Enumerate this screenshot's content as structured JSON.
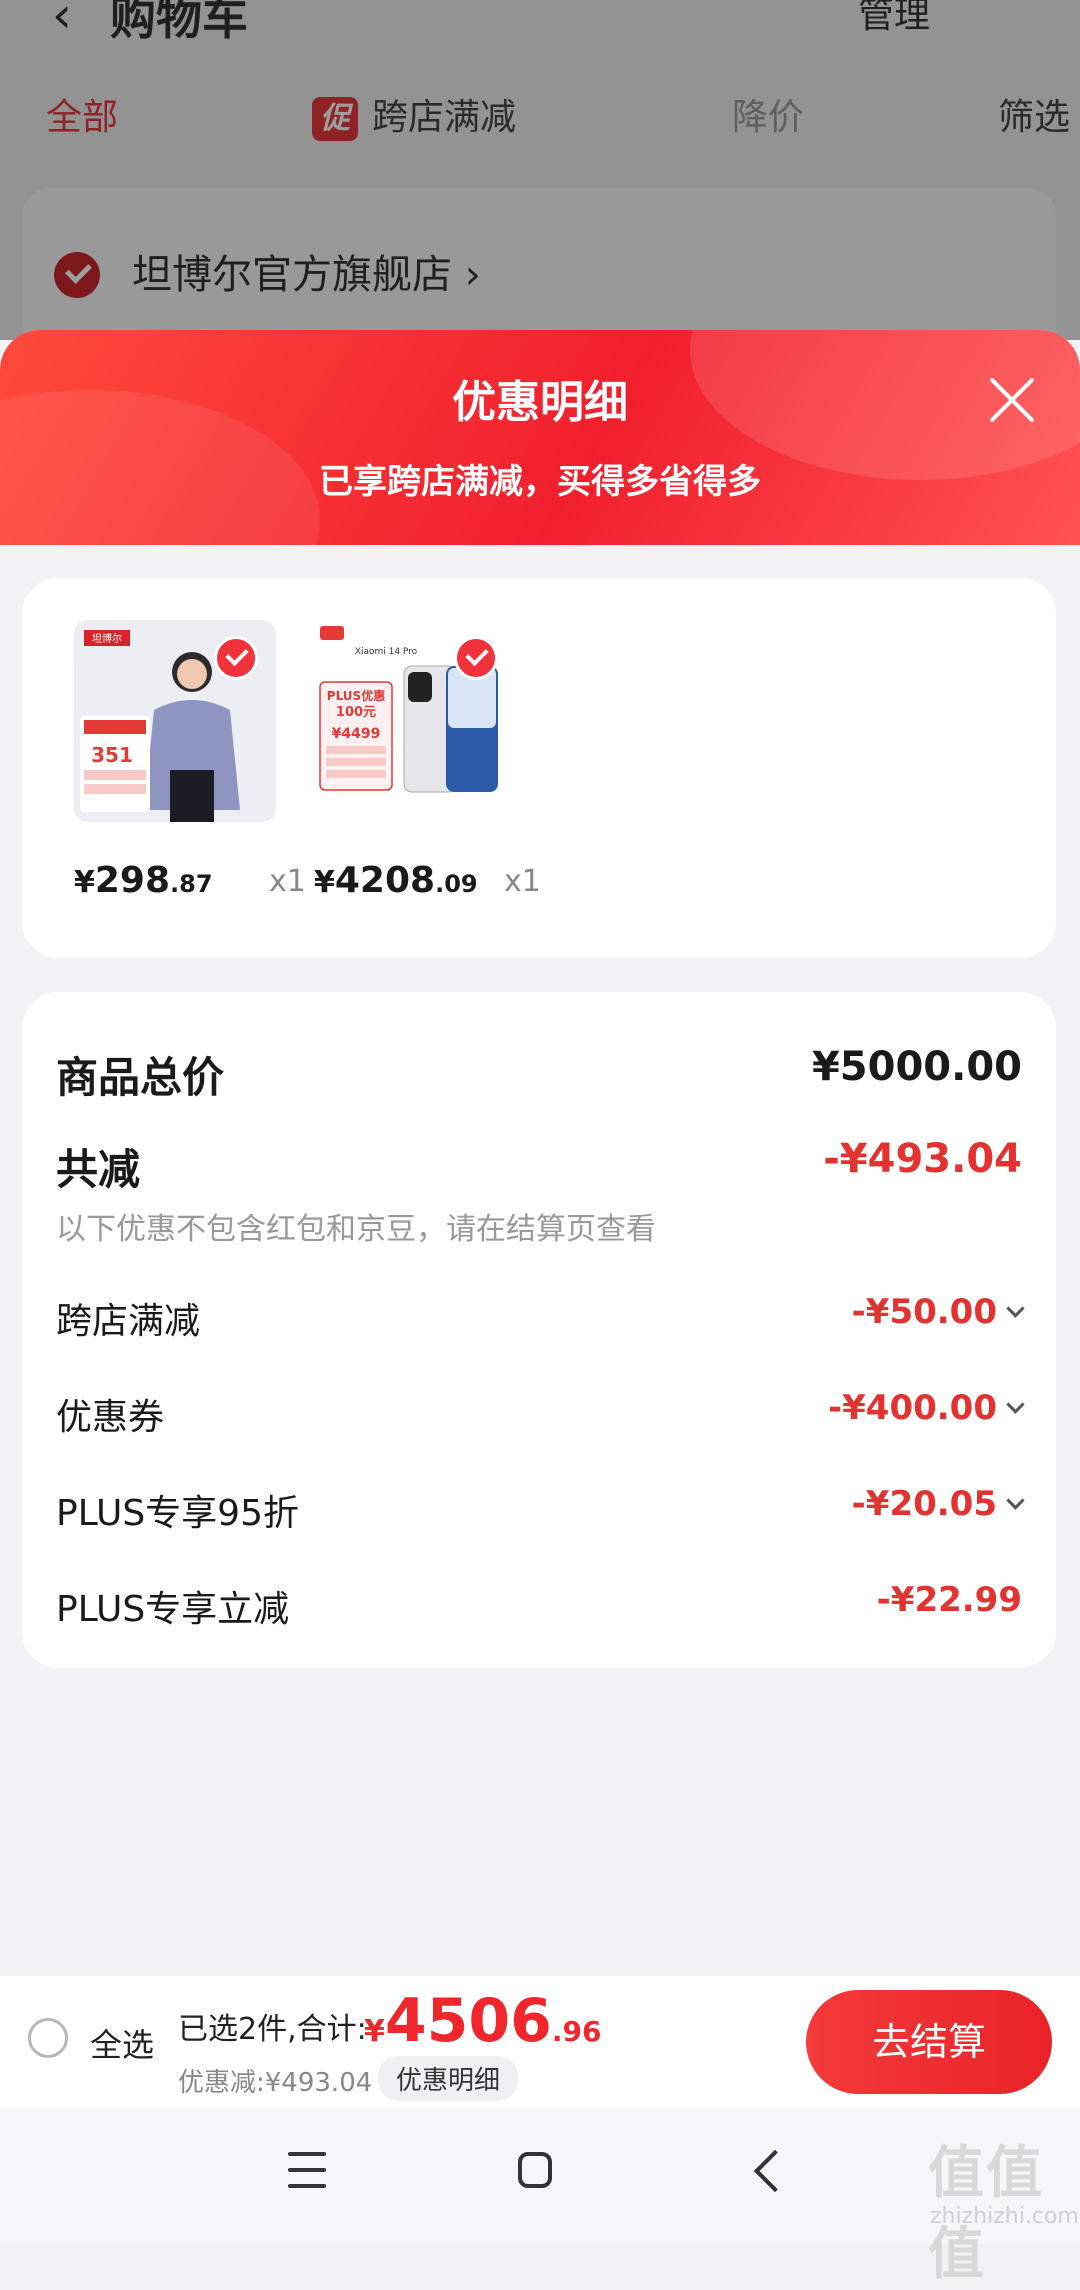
{
  "background": {
    "title": "购物车",
    "manage": "管理",
    "tabs": [
      {
        "label": "全部"
      },
      {
        "label": "跨店满减",
        "badge": "促"
      },
      {
        "label": "降价"
      },
      {
        "label": "筛选"
      }
    ],
    "store_name": "坦博尔官方旗舰店"
  },
  "sheet": {
    "title": "优惠明细",
    "subtitle": "已享跨店满减，买得多省得多",
    "products": [
      {
        "price_symbol": "¥",
        "price_int": "298",
        "price_dec": ".87",
        "qty": "x1",
        "thumb_title": "坦博尔",
        "thumb_price": "351"
      },
      {
        "price_symbol": "¥",
        "price_int": "4208",
        "price_dec": ".09",
        "qty": "x1",
        "thumb_title": "Xiaomi 14 Pro",
        "thumb_promo": "PLUS优惠",
        "thumb_promo_amount": "100元",
        "thumb_price": "¥4499"
      }
    ],
    "summary": {
      "total_label": "商品总价",
      "total_value": "¥5000.00",
      "reduce_label": "共减",
      "reduce_value": "-¥493.04",
      "note": "以下优惠不包含红包和京豆，请在结算页查看",
      "items": [
        {
          "label": "跨店满减",
          "value": "-¥50.00",
          "expandable": true
        },
        {
          "label": "优惠券",
          "value": "-¥400.00",
          "expandable": true
        },
        {
          "label": "PLUS专享95折",
          "value": "-¥20.05",
          "expandable": true
        },
        {
          "label": "PLUS专享立减",
          "value": "-¥22.99",
          "expandable": false
        }
      ]
    }
  },
  "bottom_bar": {
    "select_all": "全选",
    "selected_text": "已选2件,合计:",
    "total_symbol": "¥",
    "total_int": "4506",
    "total_dec": ".96",
    "discount_text": "优惠减:¥493.04",
    "detail_chip": "优惠明细",
    "checkout": "去结算"
  },
  "watermark": {
    "text": "值值值",
    "sub": "zhizhizhi.com"
  },
  "colors": {
    "accent": "#e33230",
    "header_red": "#f11f2d"
  }
}
